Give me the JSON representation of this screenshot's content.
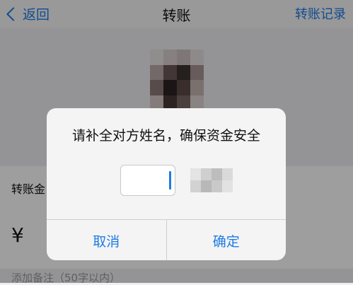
{
  "nav": {
    "back_label": "返回",
    "title": "转账",
    "right_label": "转账记录"
  },
  "form": {
    "amount_label": "转账金",
    "currency_symbol": "¥",
    "note_placeholder": "添加备注（50字以内）"
  },
  "dialog": {
    "title": "请补全对方姓名，确保资金安全",
    "input_value": "",
    "cancel_label": "取消",
    "confirm_label": "确定"
  },
  "colors": {
    "accent": "#1f7be5",
    "overlay": "rgba(0,0,0,0.38)"
  }
}
